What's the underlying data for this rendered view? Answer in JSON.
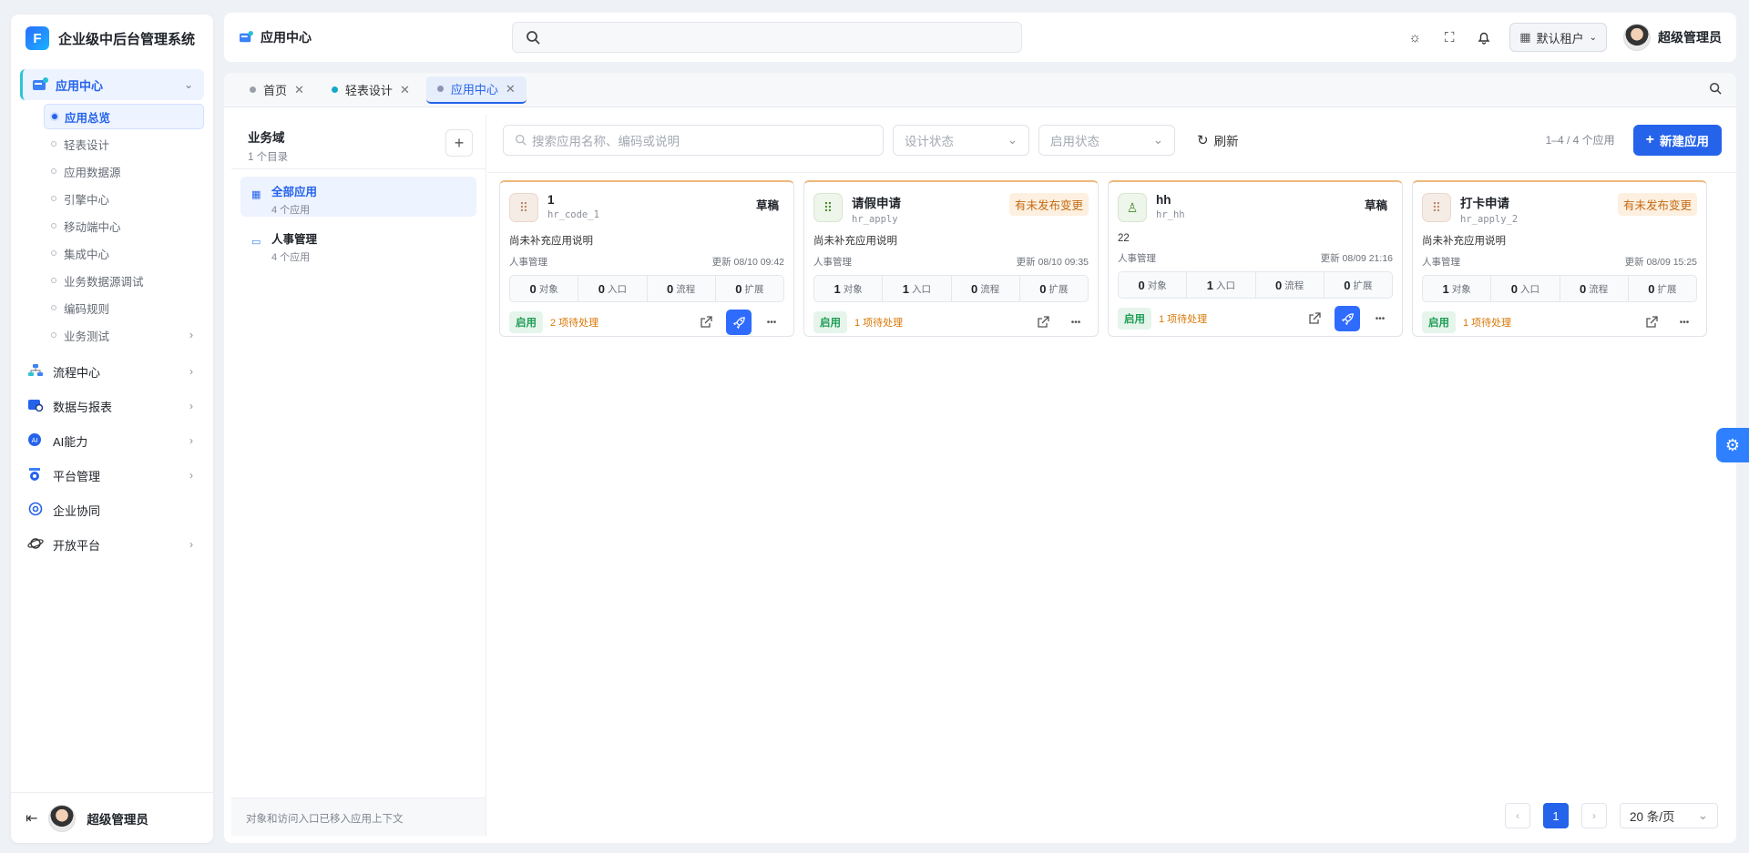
{
  "brand": {
    "logo": "F",
    "title": "企业级中后台管理系统"
  },
  "sidebar": {
    "active_group": {
      "label": "应用中心",
      "icon": "app-center-icon"
    },
    "sub_items": [
      {
        "label": "应用总览",
        "active": true
      },
      {
        "label": "轻表设计"
      },
      {
        "label": "应用数据源"
      },
      {
        "label": "引擎中心"
      },
      {
        "label": "移动端中心"
      },
      {
        "label": "集成中心"
      },
      {
        "label": "业务数据源调试"
      },
      {
        "label": "编码规则"
      },
      {
        "label": "业务测试",
        "has_children": true
      }
    ],
    "groups": [
      {
        "label": "流程中心",
        "icon": "flow-icon",
        "arrow": true
      },
      {
        "label": "数据与报表",
        "icon": "report-icon",
        "arrow": true
      },
      {
        "label": "AI能力",
        "icon": "ai-icon",
        "arrow": true
      },
      {
        "label": "平台管理",
        "icon": "platform-icon",
        "arrow": true
      },
      {
        "label": "企业协同",
        "icon": "collab-icon",
        "arrow": false
      },
      {
        "label": "开放平台",
        "icon": "open-icon",
        "arrow": true
      }
    ],
    "footer_user": "超级管理员"
  },
  "topbar": {
    "title": "应用中心",
    "search_placeholder": "",
    "tenant": "默认租户",
    "user": "超级管理员"
  },
  "tabs": [
    {
      "label": "首页",
      "dot": "gray"
    },
    {
      "label": "轻表设计",
      "dot": "teal"
    },
    {
      "label": "应用中心",
      "dot": "gray",
      "active": true
    }
  ],
  "domains": {
    "title": "业务域",
    "subtitle": "1 个目录",
    "items": [
      {
        "name": "全部应用",
        "count": "4 个应用",
        "active": true
      },
      {
        "name": "人事管理",
        "count": "4 个应用"
      }
    ],
    "footer": "对象和访问入口已移入应用上下文"
  },
  "toolbar": {
    "search_placeholder": "搜索应用名称、编码或说明",
    "design_status": "设计状态",
    "enable_status": "启用状态",
    "refresh": "刷新",
    "count": "1–4 / 4 个应用",
    "new_app": "新建应用"
  },
  "apps": [
    {
      "name": "1",
      "code": "hr_code_1",
      "badge": "草稿",
      "badge_type": "draft",
      "icon": "grid-icon",
      "icon_color": "brown",
      "desc": "尚未补充应用说明",
      "domain": "人事管理",
      "updated": "更新 08/10 09:42",
      "stats": [
        {
          "n": "0",
          "l": "对象"
        },
        {
          "n": "0",
          "l": "入口"
        },
        {
          "n": "0",
          "l": "流程"
        },
        {
          "n": "0",
          "l": "扩展"
        }
      ],
      "status": "启用",
      "pending": "2 项待处理",
      "rocket": true
    },
    {
      "name": "请假申请",
      "code": "hr_apply",
      "badge": "有未发布变更",
      "badge_type": "unpub",
      "icon": "grid-icon",
      "icon_color": "green",
      "desc": "尚未补充应用说明",
      "domain": "人事管理",
      "updated": "更新 08/10 09:35",
      "stats": [
        {
          "n": "1",
          "l": "对象"
        },
        {
          "n": "1",
          "l": "入口"
        },
        {
          "n": "0",
          "l": "流程"
        },
        {
          "n": "0",
          "l": "扩展"
        }
      ],
      "status": "启用",
      "pending": "1 项待处理",
      "rocket": false
    },
    {
      "name": "hh",
      "code": "hr_hh",
      "badge": "草稿",
      "badge_type": "draft",
      "icon": "person-icon",
      "icon_color": "green",
      "desc": "22",
      "domain": "人事管理",
      "updated": "更新 08/09 21:16",
      "stats": [
        {
          "n": "0",
          "l": "对象"
        },
        {
          "n": "1",
          "l": "入口"
        },
        {
          "n": "0",
          "l": "流程"
        },
        {
          "n": "0",
          "l": "扩展"
        }
      ],
      "status": "启用",
      "pending": "1 项待处理",
      "rocket": true
    },
    {
      "name": "打卡申请",
      "code": "hr_apply_2",
      "badge": "有未发布变更",
      "badge_type": "unpub",
      "icon": "grid-icon",
      "icon_color": "brown",
      "desc": "尚未补充应用说明",
      "domain": "人事管理",
      "updated": "更新 08/09 15:25",
      "stats": [
        {
          "n": "1",
          "l": "对象"
        },
        {
          "n": "0",
          "l": "入口"
        },
        {
          "n": "0",
          "l": "流程"
        },
        {
          "n": "0",
          "l": "扩展"
        }
      ],
      "status": "启用",
      "pending": "1 项待处理",
      "rocket": false
    }
  ],
  "pagination": {
    "current": "1",
    "page_size": "20 条/页"
  },
  "colors": {
    "primary": "#2563eb",
    "success": "#1f9d55",
    "warning": "#d97706"
  }
}
